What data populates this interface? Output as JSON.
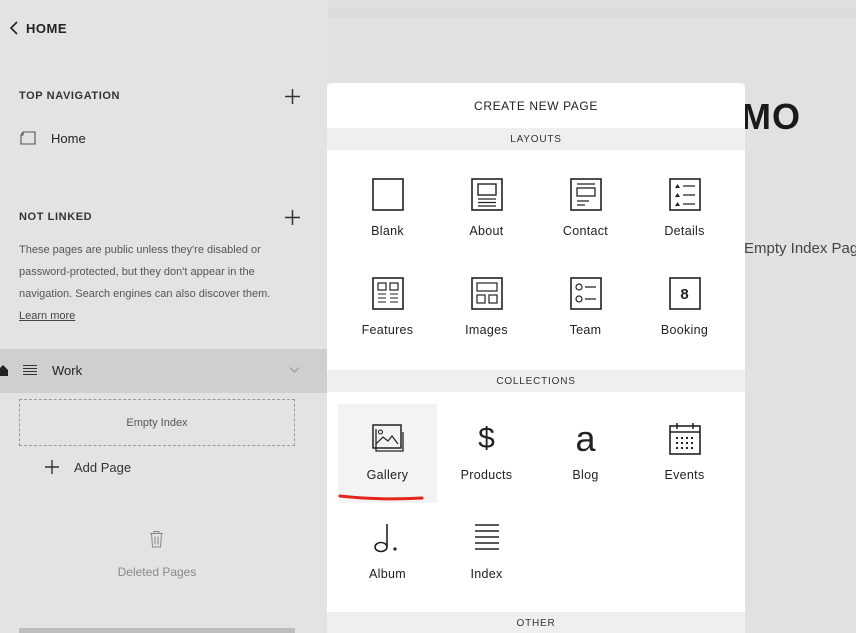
{
  "sidebar": {
    "home_label": "HOME",
    "top_nav_heading": "TOP NAVIGATION",
    "top_nav_items": [
      {
        "label": "Home"
      }
    ],
    "not_linked_heading": "NOT LINKED",
    "not_linked_note": "These pages are public unless they're disabled or password-protected, but they don't appear in the navigation. Search engines can also discover them.",
    "learn_more": "Learn more",
    "work_label": "Work",
    "empty_index": "Empty Index",
    "add_page": "Add Page",
    "deleted_pages": "Deleted Pages"
  },
  "preview": {
    "brand_partial": "EMO",
    "body_partial": "Empty Index Pag"
  },
  "modal": {
    "title": "CREATE NEW PAGE",
    "sections": {
      "layouts": "LAYOUTS",
      "collections": "COLLECTIONS",
      "other": "OTHER"
    },
    "layouts": [
      {
        "label": "Blank",
        "icon": "blank-page-icon"
      },
      {
        "label": "About",
        "icon": "about-layout-icon"
      },
      {
        "label": "Contact",
        "icon": "contact-layout-icon"
      },
      {
        "label": "Details",
        "icon": "details-list-icon"
      },
      {
        "label": "Features",
        "icon": "features-grid-icon"
      },
      {
        "label": "Images",
        "icon": "images-grid-icon"
      },
      {
        "label": "Team",
        "icon": "team-layout-icon"
      },
      {
        "label": "Booking",
        "icon": "booking-8-icon"
      }
    ],
    "collections": [
      {
        "label": "Gallery",
        "icon": "gallery-image-icon",
        "selected": true
      },
      {
        "label": "Products",
        "icon": "dollar-icon"
      },
      {
        "label": "Blog",
        "icon": "letter-a-icon"
      },
      {
        "label": "Events",
        "icon": "calendar-icon"
      },
      {
        "label": "Album",
        "icon": "music-note-icon"
      },
      {
        "label": "Index",
        "icon": "index-lines-icon"
      }
    ],
    "booking_digit": "8",
    "products_glyph": "$",
    "blog_glyph": "a"
  },
  "colors": {
    "annotation_underline": "#e3261b",
    "sidebar_bg": "#e3e3e3",
    "selected_row": "#cfcfcf"
  }
}
